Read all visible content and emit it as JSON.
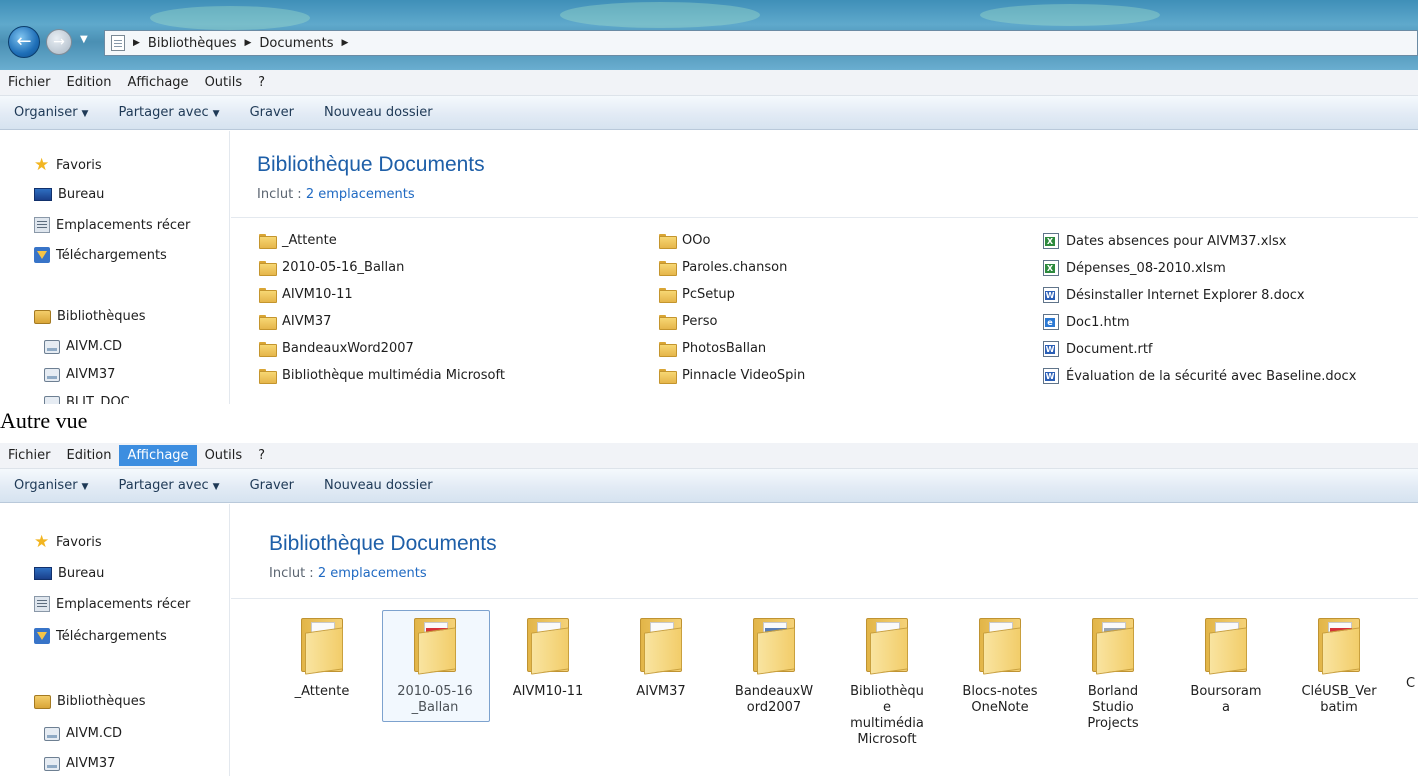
{
  "address_bar": {
    "crumbs": [
      "Bibliothèques",
      "Documents"
    ]
  },
  "menu": [
    "Fichier",
    "Edition",
    "Affichage",
    "Outils",
    "?"
  ],
  "toolbar": {
    "organize": "Organiser",
    "share": "Partager avec",
    "burn": "Graver",
    "new_folder": "Nouveau dossier"
  },
  "nav": {
    "favorites": "Favoris",
    "desktop": "Bureau",
    "recent": "Emplacements récer",
    "downloads": "Téléchargements",
    "libraries": "Bibliothèques",
    "lib_items": [
      "AIVM.CD",
      "AIVM37",
      "BLIT_DOC"
    ]
  },
  "library": {
    "title": "Bibliothèque Documents",
    "includes_label": "Inclut :",
    "includes_link": "2 emplacements"
  },
  "list_view": {
    "col1": [
      "_Attente",
      "2010-05-16_Ballan",
      "AIVM10-11",
      "AIVM37",
      "BandeauxWord2007",
      "Bibliothèque multimédia Microsoft"
    ],
    "col2": [
      "OOo",
      "Paroles.chanson",
      "PcSetup",
      "Perso",
      "PhotosBallan",
      "Pinnacle VideoSpin"
    ],
    "col3": [
      {
        "name": "Dates absences pour AIVM37.xlsx",
        "icon": "excel-icon"
      },
      {
        "name": "Dépenses_08-2010.xlsm",
        "icon": "excel-icon"
      },
      {
        "name": "Désinstaller Internet Explorer 8.docx",
        "icon": "word-icon"
      },
      {
        "name": "Doc1.htm",
        "icon": "html-icon"
      },
      {
        "name": "Document.rtf",
        "icon": "word-icon"
      },
      {
        "name": "Évaluation de la sécurité avec Baseline.docx",
        "icon": "word-icon"
      }
    ]
  },
  "caption": "Autre vue",
  "icon_view": {
    "tiles": [
      {
        "lines": [
          "_Attente"
        ]
      },
      {
        "lines": [
          "2010-05-16",
          "_Ballan"
        ]
      },
      {
        "lines": [
          "AIVM10-11"
        ]
      },
      {
        "lines": [
          "AIVM37"
        ]
      },
      {
        "lines": [
          "BandeauxW",
          "ord2007"
        ]
      },
      {
        "lines": [
          "Bibliothèqu",
          "e",
          "multimédia",
          "Microsoft"
        ]
      },
      {
        "lines": [
          "Blocs-notes",
          "OneNote"
        ]
      },
      {
        "lines": [
          "Borland",
          "Studio",
          "Projects"
        ]
      },
      {
        "lines": [
          "Boursoram",
          "a"
        ]
      },
      {
        "lines": [
          "CléUSB_Ver",
          "batim"
        ]
      }
    ],
    "partial": "C"
  }
}
